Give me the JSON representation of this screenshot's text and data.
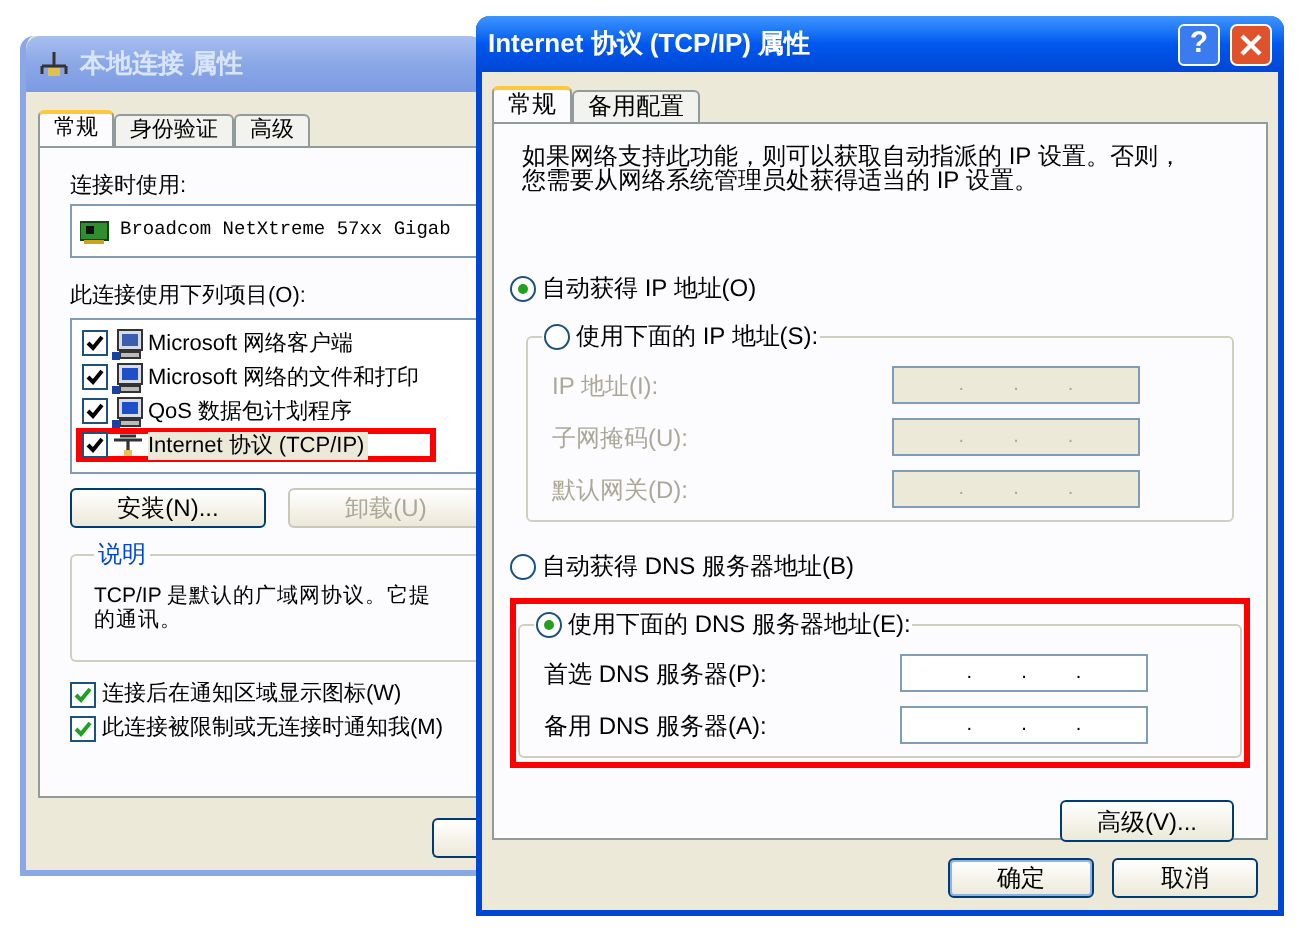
{
  "back_window": {
    "title": "本地连接 属性",
    "active": false,
    "tabs": [
      {
        "label": "常规",
        "selected": true
      },
      {
        "label": "身份验证",
        "selected": false
      },
      {
        "label": "高级",
        "selected": false
      }
    ],
    "adapter_label": "连接时使用:",
    "adapter": "Broadcom NetXtreme 57xx Gigab",
    "components_label": "此连接使用下列项目(O):",
    "components": [
      {
        "kind": "client",
        "label": "Microsoft 网络客户端",
        "checked": true,
        "selected": false,
        "highlighted": false
      },
      {
        "kind": "service",
        "label": "Microsoft 网络的文件和打印",
        "checked": true,
        "selected": false,
        "highlighted": false
      },
      {
        "kind": "service",
        "label": "QoS 数据包计划程序",
        "checked": true,
        "selected": false,
        "highlighted": false
      },
      {
        "kind": "protocol",
        "label": "Internet 协议 (TCP/IP)",
        "checked": true,
        "selected": true,
        "highlighted": true
      }
    ],
    "buttons": [
      {
        "label": "安装(N)...",
        "disabled": false
      },
      {
        "label": "卸载(U)",
        "disabled": true
      }
    ],
    "description": {
      "title": "说明",
      "lines": [
        "TCP/IP 是默认的广域网协议。它提",
        "的通讯。"
      ]
    },
    "options": [
      {
        "label": "连接后在通知区域显示图标(W)",
        "checked": true
      },
      {
        "label": "此连接被限制或无连接时通知我(M)",
        "checked": true
      }
    ]
  },
  "front_window": {
    "title": "Internet 协议 (TCP/IP) 属性",
    "active": true,
    "help_button": "?",
    "tabs": [
      {
        "label": "常规",
        "selected": true
      },
      {
        "label": "备用配置",
        "selected": false
      }
    ],
    "intro": [
      "如果网络支持此功能，则可以获取自动指派的 IP 设置。否则，",
      "您需要从网络系统管理员处获得适当的 IP 设置。"
    ],
    "ip_modes": [
      {
        "kind": "plain",
        "label": "自动获得 IP 地址(O)",
        "selected": true,
        "highlighted": false
      },
      {
        "kind": "group",
        "label": "使用下面的 IP 地址(S):",
        "selected": false,
        "highlighted": false,
        "fields": [
          {
            "label": "IP 地址(I):",
            "disabled": true,
            "separators": [
              ".",
              ".",
              "."
            ]
          },
          {
            "label": "子网掩码(U):",
            "disabled": true,
            "separators": [
              ".",
              ".",
              "."
            ]
          },
          {
            "label": "默认网关(D):",
            "disabled": true,
            "separators": [
              ".",
              ".",
              "."
            ]
          }
        ]
      }
    ],
    "dns_modes": [
      {
        "kind": "plain",
        "label": "自动获得 DNS 服务器地址(B)",
        "selected": false,
        "highlighted": false
      },
      {
        "kind": "group",
        "label": "使用下面的 DNS 服务器地址(E):",
        "selected": true,
        "highlighted": true,
        "fields": [
          {
            "label": "首选 DNS 服务器(P):",
            "disabled": false,
            "separators": [
              ".",
              ".",
              "."
            ]
          },
          {
            "label": "备用 DNS 服务器(A):",
            "disabled": false,
            "separators": [
              ".",
              ".",
              "."
            ]
          }
        ]
      }
    ],
    "advanced_button": "高级(V)...",
    "buttons": [
      {
        "label": "确定",
        "default": true
      },
      {
        "label": "取消",
        "default": false
      }
    ]
  }
}
